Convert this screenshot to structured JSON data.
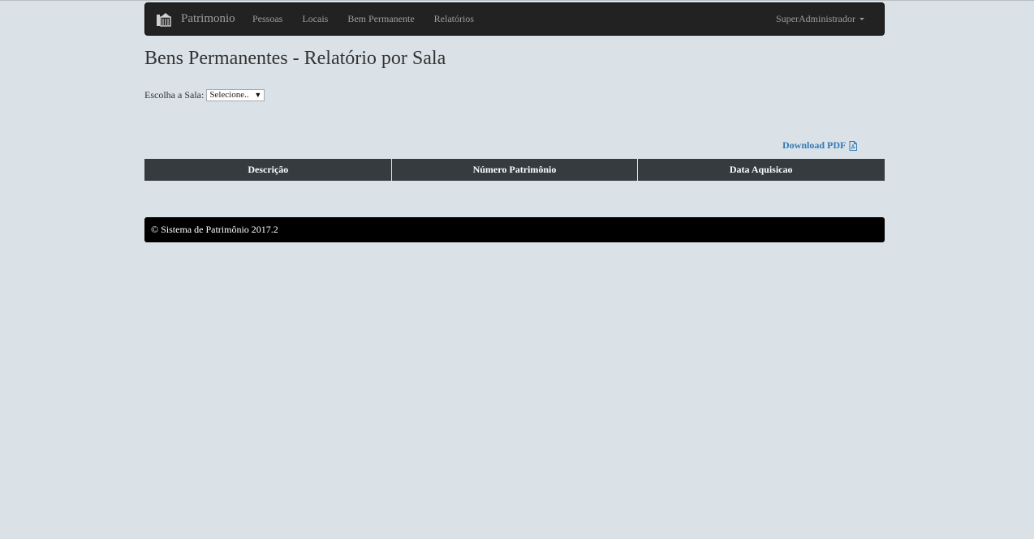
{
  "navbar": {
    "brand": "Patrimonio",
    "brand_icon": "building-icon",
    "items": [
      {
        "label": "Pessoas"
      },
      {
        "label": "Locais"
      },
      {
        "label": "Bem Permanente"
      },
      {
        "label": "Relatórios"
      }
    ],
    "user": "SuperAdministrador"
  },
  "page": {
    "title": "Bens Permanentes - Relatório por Sala"
  },
  "room_filter": {
    "label": "Escolha a Sala:",
    "selected": "Selecione..",
    "arrow": "▼"
  },
  "download": {
    "label": "Download PDF",
    "icon": "pdf-file-icon"
  },
  "table": {
    "columns": [
      "Descrição",
      "Número Patrimônio",
      "Data Aquisicao"
    ],
    "rows": []
  },
  "footer": {
    "text": "© Sistema de Patrimônio 2017.2"
  },
  "colors": {
    "background": "#dae2e7",
    "navbar": "#222222",
    "table_header": "#363b3f",
    "footer": "#000000",
    "link": "#337ab7"
  }
}
